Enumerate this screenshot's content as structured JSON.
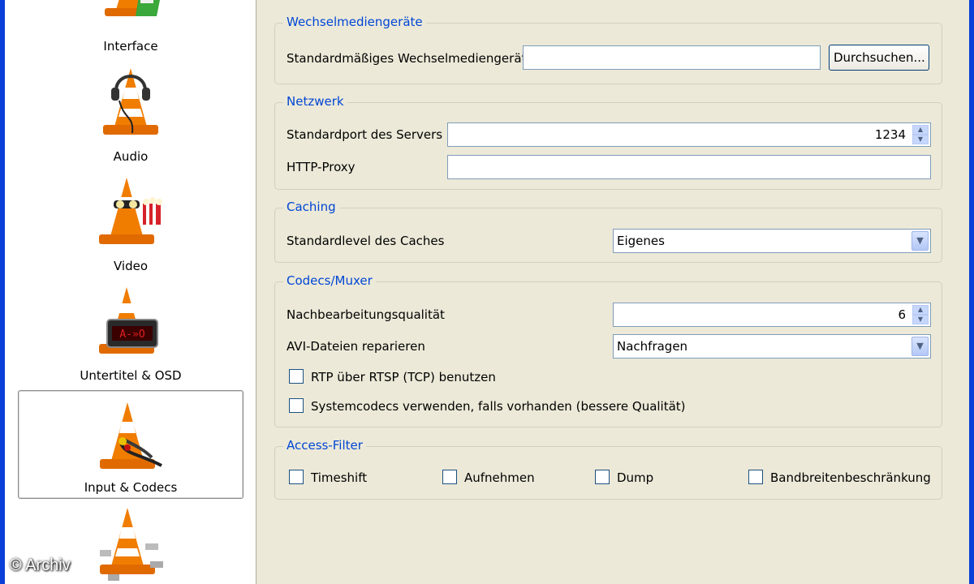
{
  "sidebar": {
    "categories": [
      {
        "label": "Interface"
      },
      {
        "label": "Audio"
      },
      {
        "label": "Video"
      },
      {
        "label": "Untertitel & OSD"
      },
      {
        "label": "Input & Codecs"
      },
      {
        "label": ""
      }
    ],
    "selected": "Input & Codecs"
  },
  "groups": {
    "removable": {
      "title": "Wechselmediengeräte",
      "device_label": "Standardmäßiges Wechselmediengerät",
      "device_value": "",
      "browse_label": "Durchsuchen..."
    },
    "network": {
      "title": "Netzwerk",
      "port_label": "Standardport des Servers",
      "port_value": "1234",
      "proxy_label": "HTTP-Proxy",
      "proxy_value": ""
    },
    "caching": {
      "title": "Caching",
      "level_label": "Standardlevel des Caches",
      "level_value": "Eigenes"
    },
    "codecs": {
      "title": "Codecs/Muxer",
      "pp_label": "Nachbearbeitungsqualität",
      "pp_value": "6",
      "avi_label": "AVI-Dateien reparieren",
      "avi_value": "Nachfragen",
      "rtp_label": "RTP über RTSP (TCP) benutzen",
      "rtp_checked": false,
      "syscodec_label": "Systemcodecs verwenden, falls vorhanden (bessere Qualität)",
      "syscodec_checked": false
    },
    "access": {
      "title": "Access-Filter",
      "timeshift_label": "Timeshift",
      "record_label": "Aufnehmen",
      "dump_label": "Dump",
      "bandwidth_label": "Bandbreitenbeschränkung"
    }
  },
  "colors": {
    "group_title": "#0046d5",
    "frame": "#0a3fd8",
    "cone_orange": "#f07d00"
  },
  "watermark": "© Archiv"
}
